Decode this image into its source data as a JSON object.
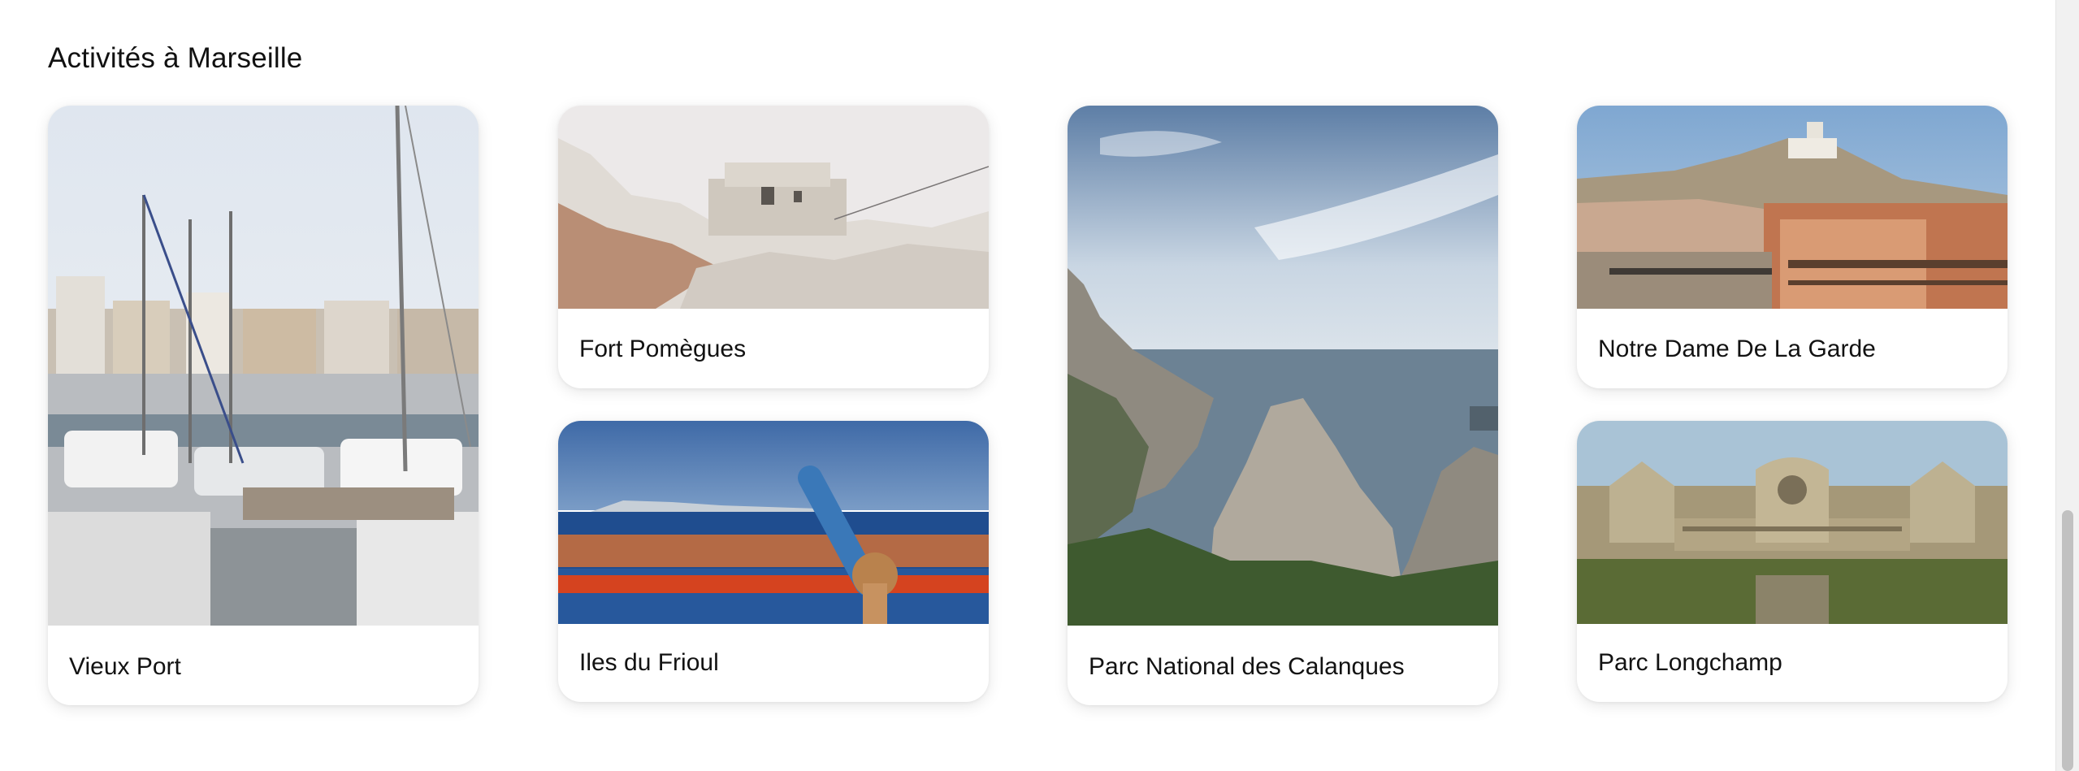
{
  "section": {
    "title": "Activités à Marseille"
  },
  "cards": [
    {
      "label": "Vieux Port",
      "image": "photo-vieux-port"
    },
    {
      "label": "Fort Pomègues",
      "image": "photo-fort-pomegues"
    },
    {
      "label": "Iles du Frioul",
      "image": "photo-iles-du-frioul"
    },
    {
      "label": "Parc National des Calanques",
      "image": "photo-calanques"
    },
    {
      "label": "Notre Dame De La Garde",
      "image": "photo-notre-dame"
    },
    {
      "label": "Parc Longchamp",
      "image": "photo-longchamp"
    }
  ],
  "colors": {
    "text": "#141414",
    "card_bg": "#ffffff",
    "page_bg": "#ffffff",
    "scrollbar_thumb": "#c1c1c1"
  }
}
